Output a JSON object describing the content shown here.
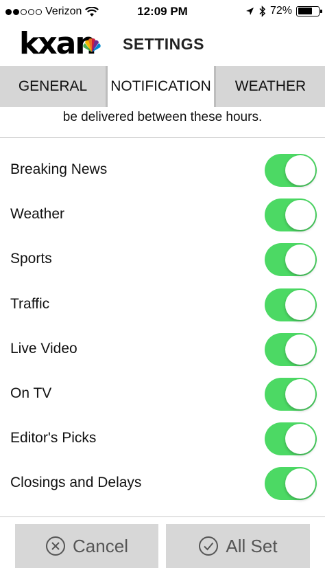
{
  "status_bar": {
    "carrier": "Verizon",
    "time": "12:09 PM",
    "battery_percent": "72%",
    "battery_level": 0.72,
    "signal_bars_filled": 2,
    "signal_bars_total": 5,
    "icons": [
      "wifi-icon",
      "location-arrow-icon",
      "bluetooth-icon",
      "battery-icon"
    ]
  },
  "header": {
    "logo_text": "kxan",
    "title": "SETTINGS"
  },
  "tabs": [
    {
      "label": "GENERAL",
      "selected": false
    },
    {
      "label": "NOTIFICATION",
      "selected": true
    },
    {
      "label": "WEATHER",
      "selected": false
    }
  ],
  "note": "be delivered between these hours.",
  "notifications": [
    {
      "label": "Breaking News",
      "enabled": true
    },
    {
      "label": "Weather",
      "enabled": true
    },
    {
      "label": "Sports",
      "enabled": true
    },
    {
      "label": "Traffic",
      "enabled": true
    },
    {
      "label": "Live Video",
      "enabled": true
    },
    {
      "label": "On TV",
      "enabled": true
    },
    {
      "label": "Editor's Picks",
      "enabled": true
    },
    {
      "label": "Closings and Delays",
      "enabled": true
    }
  ],
  "footer": {
    "cancel_label": "Cancel",
    "allset_label": "All Set"
  },
  "colors": {
    "toggle_on": "#4cd964",
    "tab_bg": "#d6d6d6",
    "button_bg": "#d7d7d7"
  }
}
